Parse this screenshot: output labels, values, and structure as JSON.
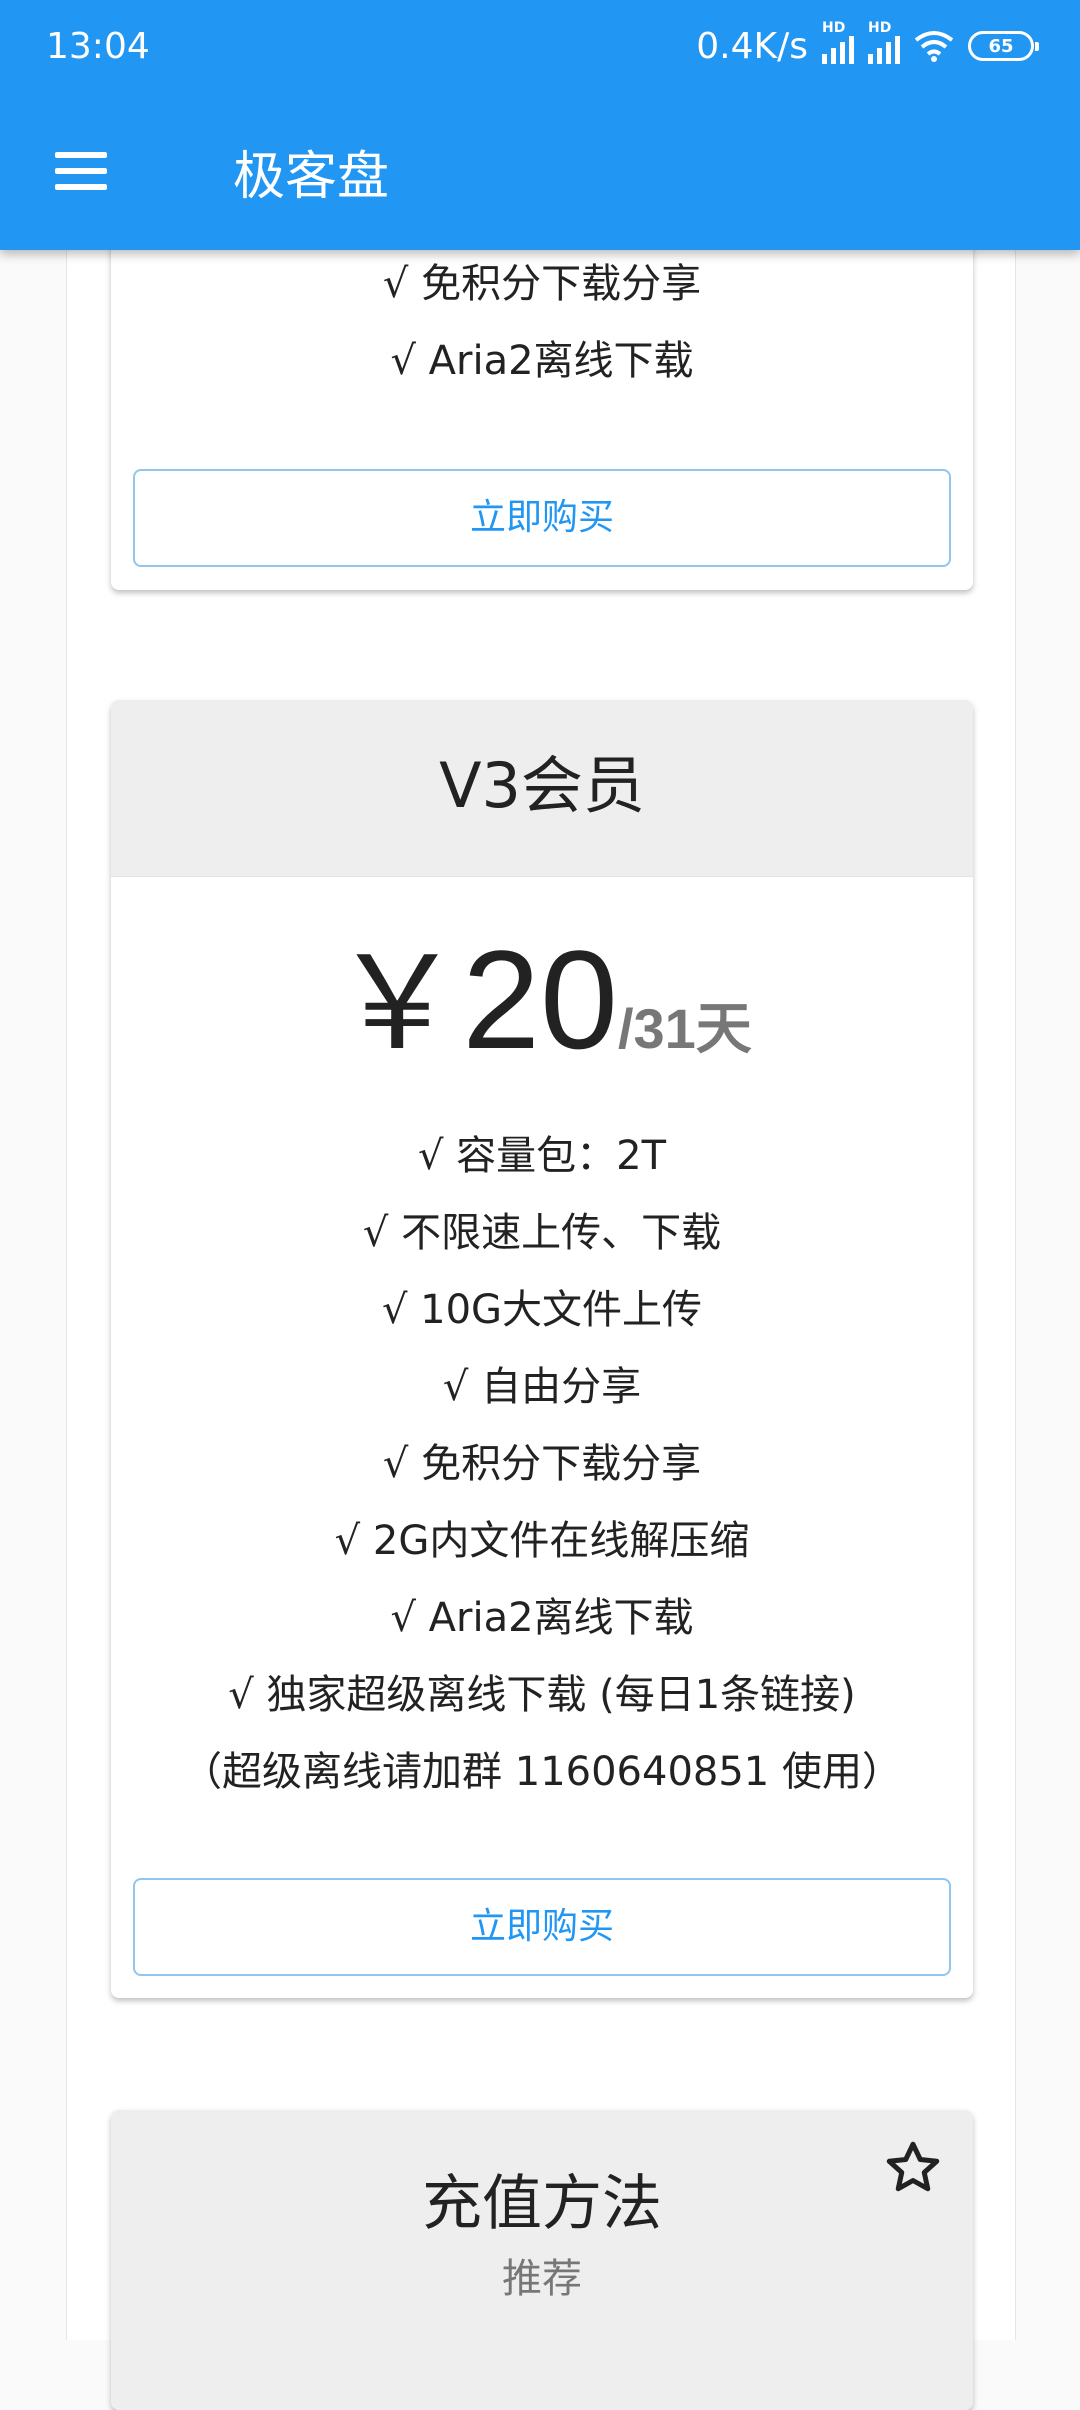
{
  "status_bar": {
    "time": "13:04",
    "net_speed": "0.4K/s",
    "hd_label": "HD",
    "battery": "65"
  },
  "app_bar": {
    "title": "极客盘",
    "menu_icon": "menu-icon"
  },
  "card_top": {
    "features": [
      "√ 免积分下载分享",
      "√ Aria2离线下载"
    ],
    "buy_label": "立即购买"
  },
  "card_v3": {
    "title": "V3会员",
    "price_symbol": "￥",
    "price_amount": "20",
    "price_period": "/31天",
    "features": [
      "√ 容量包：2T",
      "√ 不限速上传、下载",
      "√ 10G大文件上传",
      "√ 自由分享",
      "√ 免积分下载分享",
      "√ 2G内文件在线解压缩",
      "√ Aria2离线下载",
      "√ 独家超级离线下载 (每日1条链接)",
      "（超级离线请加群 1160640851 使用）"
    ],
    "buy_label": "立即购买"
  },
  "card_recharge": {
    "title": "充值方法",
    "subtitle": "推荐",
    "star_icon": "star-outline-icon"
  },
  "colors": {
    "primary": "#2196f3",
    "button_border": "#8ec6ef",
    "card_header": "#eeeeee"
  }
}
